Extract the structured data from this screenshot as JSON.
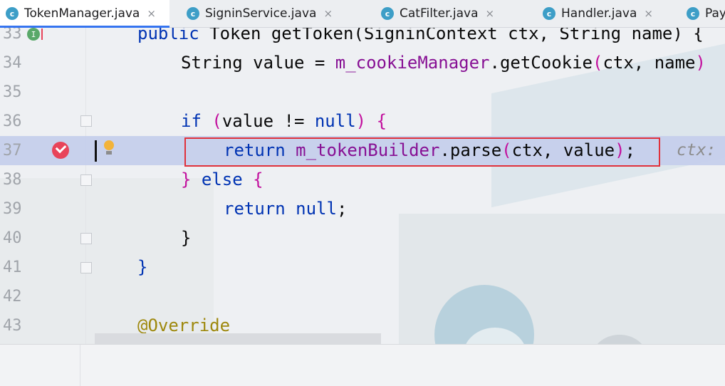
{
  "tabs": [
    {
      "label": "TokenManager.java",
      "icon": "class-icon",
      "active": true
    },
    {
      "label": "SigninService.java",
      "icon": "class-icon",
      "active": false
    },
    {
      "label": "CatFilter.java",
      "icon": "class-icon",
      "active": false
    },
    {
      "label": "Handler.java",
      "icon": "class-icon",
      "active": false
    },
    {
      "label": "Pay",
      "icon": "class-icon",
      "active": false
    }
  ],
  "tab_icon_letter": "c",
  "close_glyph": "×",
  "editor": {
    "lines": [
      {
        "num": "33",
        "text": "public Token getToken(SigninContext ctx, String name) {"
      },
      {
        "num": "34",
        "text": "String value = m_cookieManager.getCookie(ctx, name)"
      },
      {
        "num": "35",
        "text": ""
      },
      {
        "num": "36",
        "text": "if (value != null) {"
      },
      {
        "num": "37",
        "text": "return m_tokenBuilder.parse(ctx, value);"
      },
      {
        "num": "38",
        "text": "} else {"
      },
      {
        "num": "39",
        "text": "return null;"
      },
      {
        "num": "40",
        "text": "}"
      },
      {
        "num": "41",
        "text": "}"
      },
      {
        "num": "42",
        "text": ""
      },
      {
        "num": "43",
        "text": "@Override"
      }
    ],
    "line37_hint": "ctx:",
    "highlighted_line": "37",
    "breakpoint_line": "37",
    "colors": {
      "keyword": "#0033b3",
      "field": "#871094",
      "bracket": "#c20f9d",
      "annotation": "#9e880d",
      "highlight": "#c4ceeb",
      "breakpoint": "#e8445a",
      "selection_border": "#e0313b"
    }
  }
}
